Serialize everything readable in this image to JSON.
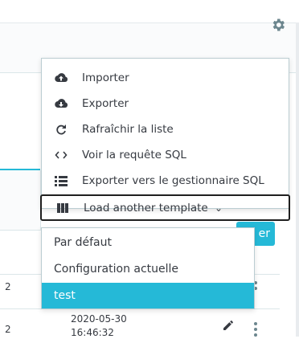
{
  "menu": {
    "items": [
      {
        "label": "Importer",
        "icon": "cloud-upload-icon"
      },
      {
        "label": "Exporter",
        "icon": "cloud-download-icon"
      },
      {
        "label": "Rafraîchir la liste",
        "icon": "refresh-icon"
      },
      {
        "label": "Voir la requête SQL",
        "icon": "code-icon"
      },
      {
        "label": "Exporter vers le gestionnaire SQL",
        "icon": "list-icon"
      },
      {
        "label": "Load another template",
        "icon": "columns-icon",
        "chevron": "⌄"
      }
    ]
  },
  "templates": {
    "options": [
      "Par défaut",
      "Configuration actuelle",
      "test"
    ],
    "selected": "test"
  },
  "table": {
    "filter_button_partial": "er",
    "rows": [
      {
        "id_partial": "2",
        "date_partial": ""
      },
      {
        "id_partial": "2",
        "date": "2020-05-30",
        "time_partial": "16:46:32"
      }
    ]
  },
  "colors": {
    "accent": "#25b9d7",
    "text": "#363a41",
    "border": "#bbcdd2"
  }
}
